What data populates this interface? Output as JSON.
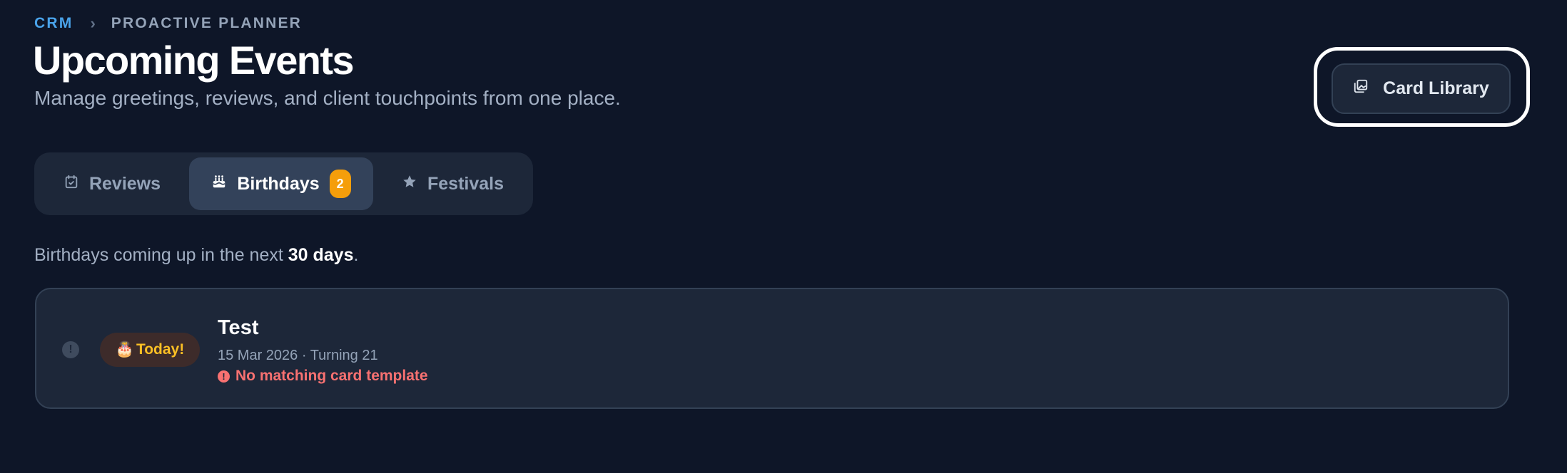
{
  "breadcrumb": {
    "root": "CRM",
    "separator": "›",
    "current": "PROACTIVE PLANNER"
  },
  "header": {
    "title": "Upcoming Events",
    "subtitle": "Manage greetings, reviews, and client touchpoints from one place."
  },
  "card_library_button": {
    "label": "Card Library",
    "icon": "image-stack-icon"
  },
  "tabs": [
    {
      "label": "Reviews",
      "icon": "calendar-check-icon",
      "active": false
    },
    {
      "label": "Birthdays",
      "icon": "cake-icon",
      "active": true,
      "count": "2"
    },
    {
      "label": "Festivals",
      "icon": "star-icon",
      "active": false
    }
  ],
  "range": {
    "prefix": "Birthdays coming up in the next ",
    "days": "30 days",
    "suffix": "."
  },
  "events": [
    {
      "badge_emoji": "🎂",
      "badge_label": "Today!",
      "name": "Test",
      "meta": "15 Mar 2026 · Turning 21",
      "warning": "No matching card template",
      "info_glyph": "!",
      "warning_glyph": "!"
    }
  ],
  "colors": {
    "background": "#0e1628",
    "surface": "#1d2739",
    "accent_link": "#4aa3ea",
    "badge_orange": "#f59e0b",
    "today_text": "#fbbf24",
    "warning_red": "#f87171"
  }
}
